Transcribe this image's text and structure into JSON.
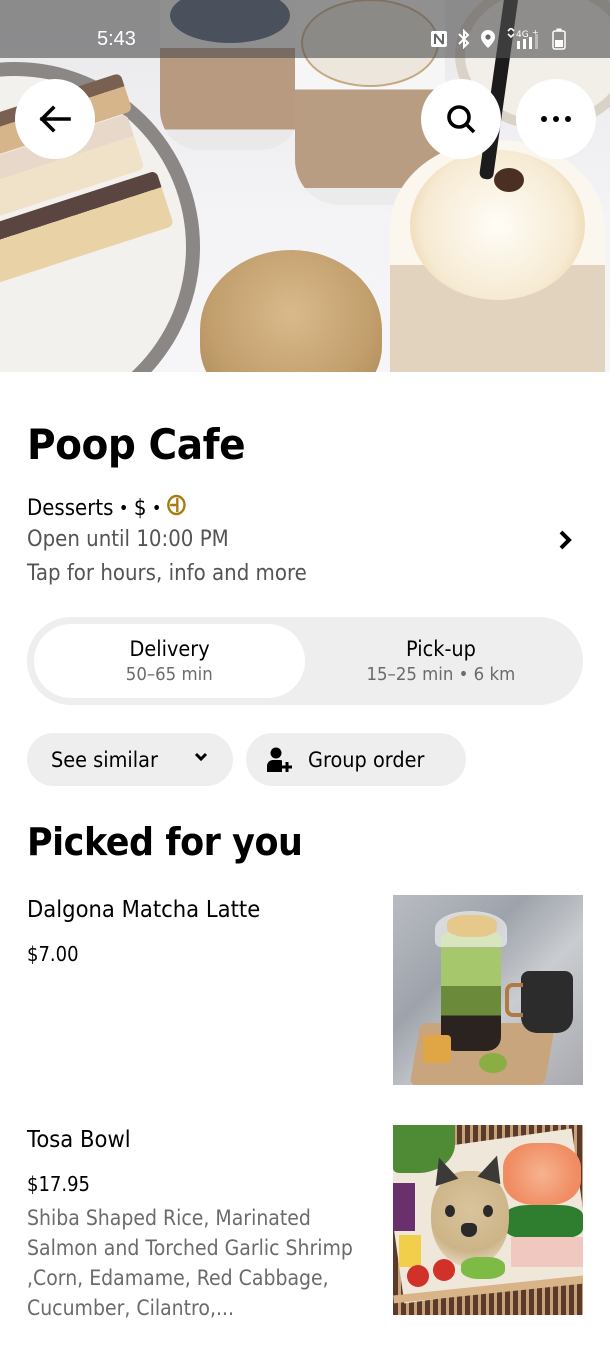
{
  "status_bar": {
    "time": "5:43",
    "icons": [
      "nfc-icon",
      "bluetooth-icon",
      "location-icon",
      "data-arrows-icon",
      "signal-4g-icon",
      "battery-icon"
    ],
    "network_label": "4G"
  },
  "header": {
    "back_icon": "arrow-left-icon",
    "search_icon": "search-icon",
    "more_icon": "more-horizontal-icon",
    "hero_image": "cafe-desserts-and-drinks-photo"
  },
  "store": {
    "name": "Poop Cafe",
    "category": "Desserts",
    "price_level": "$",
    "separator": "•",
    "badge_icon": "dashpass-icon",
    "badge_color": "#a87b12",
    "hours": "Open until 10:00 PM",
    "info_hint": "Tap for hours, info and more"
  },
  "fulfillment": {
    "selected": "Delivery",
    "options": [
      {
        "label": "Delivery",
        "detail": "50–65 min"
      },
      {
        "label": "Pick-up",
        "detail": "15–25 min • 6 km"
      }
    ]
  },
  "actions": {
    "see_similar": "See similar",
    "group_order": "Group order"
  },
  "section": {
    "title": "Picked for you",
    "items": [
      {
        "name": "Dalgona Matcha Latte",
        "price": "$7.00",
        "description": "",
        "image": "matcha-latte-photo"
      },
      {
        "name": "Tosa Bowl",
        "price": "$17.95",
        "description": "Shiba Shaped Rice,  Marinated Salmon and Torched Garlic Shrimp ,Corn, Edamame, Red Cabbage, Cucumber, Cilantro,...",
        "image": "tosa-bowl-photo"
      }
    ]
  },
  "colors": {
    "text_primary": "#000000",
    "text_secondary": "#545454",
    "chip_bg": "#eeeeee",
    "badge_gold": "#a87b12"
  }
}
